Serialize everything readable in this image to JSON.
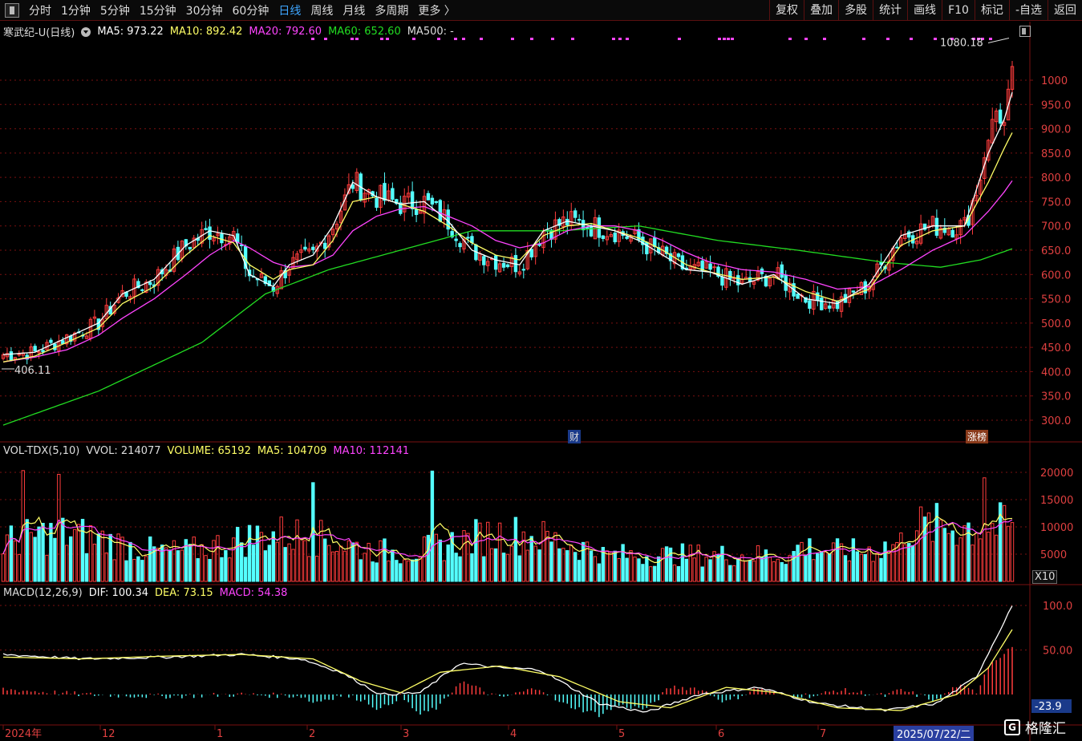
{
  "toolbar": {
    "periods": [
      "分时",
      "1分钟",
      "5分钟",
      "15分钟",
      "30分钟",
      "60分钟",
      "日线",
      "周线",
      "月线",
      "多周期",
      "更多 〉"
    ],
    "active_period": "日线",
    "right_buttons": [
      "复权",
      "叠加",
      "多股",
      "统计",
      "画线",
      "F10",
      "标记",
      "-自选",
      "返回"
    ]
  },
  "main_legend": {
    "title": "寒武纪-U(日线)",
    "ma5": "MA5: 973.22",
    "ma10": "MA10: 892.42",
    "ma20": "MA20: 792.60",
    "ma60": "MA60: 652.60",
    "ma500": "MA500: -"
  },
  "vol_legend": {
    "title": "VOL-TDX(5,10)",
    "vvol": "VVOL: 214077",
    "volume": "VOLUME: 65192",
    "ma5": "MA5: 104709",
    "ma10": "MA10: 112141"
  },
  "macd_legend": {
    "title": "MACD(12,26,9)",
    "dif": "DIF: 100.34",
    "dea": "DEA: 73.15",
    "macd": "MACD: 54.38"
  },
  "price_axis": [
    "1000",
    "950.0",
    "900.0",
    "850.0",
    "800.0",
    "750.0",
    "700.0",
    "650.0",
    "600.0",
    "550.0",
    "500.0",
    "450.0",
    "400.0",
    "350.0",
    "300.0"
  ],
  "vol_axis": [
    "20000",
    "15000",
    "10000",
    "5000"
  ],
  "vol_multiplier": "X10",
  "macd_axis": [
    "100.0",
    "50.00",
    "-23.9"
  ],
  "high_mark": "1080.18",
  "low_mark": "406.11",
  "badges": {
    "fin": "财",
    "rank": "涨榜"
  },
  "date_axis": [
    "2024年",
    "12",
    "1",
    "2",
    "3",
    "4",
    "5",
    "6",
    "7"
  ],
  "current_date": "2025/07/22/二",
  "watermark": "格隆汇",
  "colors": {
    "up": "#ff3c3c",
    "down": "#54ffff",
    "ma5": "#ffffff",
    "ma10": "#ffff66",
    "ma20": "#ff44ff",
    "ma60": "#22dd22",
    "grid": "#7a1010"
  },
  "chart_data": {
    "type": "candlestick",
    "ylim": [
      290,
      1090
    ],
    "ma_lines": {
      "ma5": [
        [
          0,
          435
        ],
        [
          8,
          440
        ],
        [
          16,
          470
        ],
        [
          24,
          500
        ],
        [
          30,
          560
        ],
        [
          38,
          590
        ],
        [
          46,
          660
        ],
        [
          52,
          690
        ],
        [
          58,
          680
        ],
        [
          62,
          600
        ],
        [
          68,
          575
        ],
        [
          72,
          620
        ],
        [
          78,
          640
        ],
        [
          83,
          700
        ],
        [
          88,
          790
        ],
        [
          94,
          760
        ],
        [
          100,
          745
        ],
        [
          106,
          750
        ],
        [
          112,
          710
        ],
        [
          118,
          650
        ],
        [
          124,
          630
        ],
        [
          130,
          620
        ],
        [
          136,
          690
        ],
        [
          142,
          710
        ],
        [
          148,
          700
        ],
        [
          154,
          690
        ],
        [
          160,
          670
        ],
        [
          166,
          640
        ],
        [
          172,
          610
        ],
        [
          178,
          605
        ],
        [
          186,
          580
        ],
        [
          194,
          600
        ],
        [
          202,
          550
        ],
        [
          210,
          540
        ],
        [
          218,
          580
        ],
        [
          226,
          680
        ],
        [
          234,
          700
        ],
        [
          242,
          700
        ],
        [
          248,
          850
        ],
        [
          252,
          920
        ],
        [
          254,
          975
        ]
      ],
      "ma10": [
        [
          0,
          420
        ],
        [
          8,
          432
        ],
        [
          16,
          460
        ],
        [
          24,
          490
        ],
        [
          30,
          540
        ],
        [
          38,
          575
        ],
        [
          46,
          640
        ],
        [
          52,
          680
        ],
        [
          58,
          665
        ],
        [
          62,
          620
        ],
        [
          68,
          590
        ],
        [
          72,
          610
        ],
        [
          78,
          620
        ],
        [
          83,
          670
        ],
        [
          88,
          750
        ],
        [
          94,
          760
        ],
        [
          100,
          745
        ],
        [
          106,
          730
        ],
        [
          112,
          700
        ],
        [
          118,
          665
        ],
        [
          124,
          640
        ],
        [
          130,
          630
        ],
        [
          136,
          680
        ],
        [
          142,
          700
        ],
        [
          148,
          705
        ],
        [
          154,
          690
        ],
        [
          160,
          675
        ],
        [
          166,
          650
        ],
        [
          172,
          620
        ],
        [
          178,
          605
        ],
        [
          186,
          590
        ],
        [
          194,
          595
        ],
        [
          202,
          565
        ],
        [
          210,
          545
        ],
        [
          218,
          570
        ],
        [
          226,
          660
        ],
        [
          234,
          690
        ],
        [
          242,
          700
        ],
        [
          248,
          790
        ],
        [
          252,
          860
        ],
        [
          254,
          892
        ]
      ],
      "ma20": [
        [
          0,
          420
        ],
        [
          8,
          430
        ],
        [
          16,
          445
        ],
        [
          24,
          475
        ],
        [
          30,
          510
        ],
        [
          38,
          550
        ],
        [
          46,
          600
        ],
        [
          52,
          640
        ],
        [
          58,
          670
        ],
        [
          62,
          655
        ],
        [
          68,
          625
        ],
        [
          72,
          615
        ],
        [
          78,
          620
        ],
        [
          83,
          640
        ],
        [
          88,
          690
        ],
        [
          94,
          720
        ],
        [
          100,
          735
        ],
        [
          106,
          740
        ],
        [
          112,
          720
        ],
        [
          118,
          700
        ],
        [
          124,
          670
        ],
        [
          130,
          655
        ],
        [
          136,
          665
        ],
        [
          142,
          690
        ],
        [
          148,
          700
        ],
        [
          154,
          700
        ],
        [
          160,
          690
        ],
        [
          166,
          670
        ],
        [
          172,
          645
        ],
        [
          178,
          625
        ],
        [
          186,
          610
        ],
        [
          194,
          605
        ],
        [
          202,
          590
        ],
        [
          210,
          570
        ],
        [
          218,
          575
        ],
        [
          226,
          610
        ],
        [
          234,
          650
        ],
        [
          242,
          680
        ],
        [
          248,
          730
        ],
        [
          252,
          770
        ],
        [
          254,
          793
        ]
      ],
      "ma60": [
        [
          0,
          290
        ],
        [
          24,
          360
        ],
        [
          50,
          460
        ],
        [
          66,
          560
        ],
        [
          82,
          610
        ],
        [
          100,
          650
        ],
        [
          118,
          690
        ],
        [
          140,
          690
        ],
        [
          160,
          700
        ],
        [
          180,
          670
        ],
        [
          200,
          650
        ],
        [
          222,
          625
        ],
        [
          236,
          615
        ],
        [
          246,
          630
        ],
        [
          254,
          653
        ]
      ]
    }
  }
}
